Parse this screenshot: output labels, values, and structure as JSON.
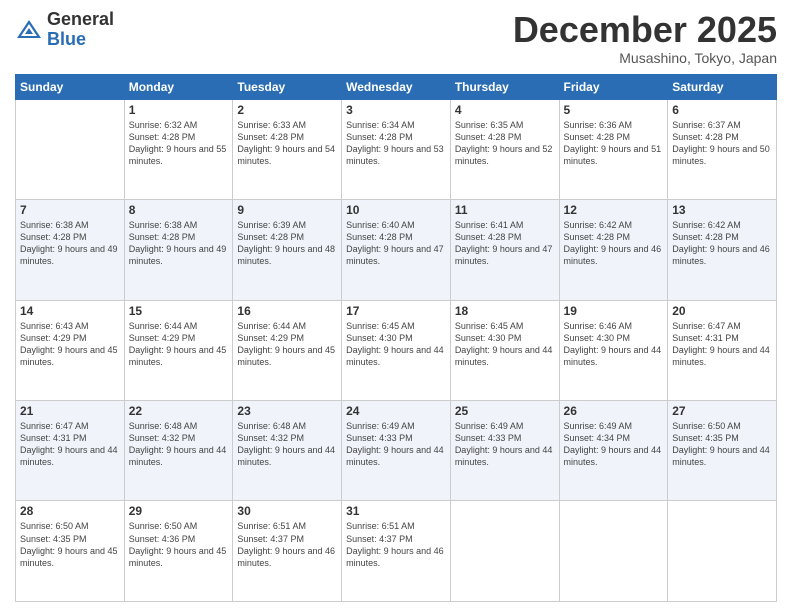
{
  "logo": {
    "general": "General",
    "blue": "Blue"
  },
  "header": {
    "month": "December 2025",
    "location": "Musashino, Tokyo, Japan"
  },
  "days": [
    "Sunday",
    "Monday",
    "Tuesday",
    "Wednesday",
    "Thursday",
    "Friday",
    "Saturday"
  ],
  "weeks": [
    [
      {
        "day": "",
        "sunrise": "",
        "sunset": "",
        "daylight": ""
      },
      {
        "day": "1",
        "sunrise": "Sunrise: 6:32 AM",
        "sunset": "Sunset: 4:28 PM",
        "daylight": "Daylight: 9 hours and 55 minutes."
      },
      {
        "day": "2",
        "sunrise": "Sunrise: 6:33 AM",
        "sunset": "Sunset: 4:28 PM",
        "daylight": "Daylight: 9 hours and 54 minutes."
      },
      {
        "day": "3",
        "sunrise": "Sunrise: 6:34 AM",
        "sunset": "Sunset: 4:28 PM",
        "daylight": "Daylight: 9 hours and 53 minutes."
      },
      {
        "day": "4",
        "sunrise": "Sunrise: 6:35 AM",
        "sunset": "Sunset: 4:28 PM",
        "daylight": "Daylight: 9 hours and 52 minutes."
      },
      {
        "day": "5",
        "sunrise": "Sunrise: 6:36 AM",
        "sunset": "Sunset: 4:28 PM",
        "daylight": "Daylight: 9 hours and 51 minutes."
      },
      {
        "day": "6",
        "sunrise": "Sunrise: 6:37 AM",
        "sunset": "Sunset: 4:28 PM",
        "daylight": "Daylight: 9 hours and 50 minutes."
      }
    ],
    [
      {
        "day": "7",
        "sunrise": "Sunrise: 6:38 AM",
        "sunset": "Sunset: 4:28 PM",
        "daylight": "Daylight: 9 hours and 49 minutes."
      },
      {
        "day": "8",
        "sunrise": "Sunrise: 6:38 AM",
        "sunset": "Sunset: 4:28 PM",
        "daylight": "Daylight: 9 hours and 49 minutes."
      },
      {
        "day": "9",
        "sunrise": "Sunrise: 6:39 AM",
        "sunset": "Sunset: 4:28 PM",
        "daylight": "Daylight: 9 hours and 48 minutes."
      },
      {
        "day": "10",
        "sunrise": "Sunrise: 6:40 AM",
        "sunset": "Sunset: 4:28 PM",
        "daylight": "Daylight: 9 hours and 47 minutes."
      },
      {
        "day": "11",
        "sunrise": "Sunrise: 6:41 AM",
        "sunset": "Sunset: 4:28 PM",
        "daylight": "Daylight: 9 hours and 47 minutes."
      },
      {
        "day": "12",
        "sunrise": "Sunrise: 6:42 AM",
        "sunset": "Sunset: 4:28 PM",
        "daylight": "Daylight: 9 hours and 46 minutes."
      },
      {
        "day": "13",
        "sunrise": "Sunrise: 6:42 AM",
        "sunset": "Sunset: 4:28 PM",
        "daylight": "Daylight: 9 hours and 46 minutes."
      }
    ],
    [
      {
        "day": "14",
        "sunrise": "Sunrise: 6:43 AM",
        "sunset": "Sunset: 4:29 PM",
        "daylight": "Daylight: 9 hours and 45 minutes."
      },
      {
        "day": "15",
        "sunrise": "Sunrise: 6:44 AM",
        "sunset": "Sunset: 4:29 PM",
        "daylight": "Daylight: 9 hours and 45 minutes."
      },
      {
        "day": "16",
        "sunrise": "Sunrise: 6:44 AM",
        "sunset": "Sunset: 4:29 PM",
        "daylight": "Daylight: 9 hours and 45 minutes."
      },
      {
        "day": "17",
        "sunrise": "Sunrise: 6:45 AM",
        "sunset": "Sunset: 4:30 PM",
        "daylight": "Daylight: 9 hours and 44 minutes."
      },
      {
        "day": "18",
        "sunrise": "Sunrise: 6:45 AM",
        "sunset": "Sunset: 4:30 PM",
        "daylight": "Daylight: 9 hours and 44 minutes."
      },
      {
        "day": "19",
        "sunrise": "Sunrise: 6:46 AM",
        "sunset": "Sunset: 4:30 PM",
        "daylight": "Daylight: 9 hours and 44 minutes."
      },
      {
        "day": "20",
        "sunrise": "Sunrise: 6:47 AM",
        "sunset": "Sunset: 4:31 PM",
        "daylight": "Daylight: 9 hours and 44 minutes."
      }
    ],
    [
      {
        "day": "21",
        "sunrise": "Sunrise: 6:47 AM",
        "sunset": "Sunset: 4:31 PM",
        "daylight": "Daylight: 9 hours and 44 minutes."
      },
      {
        "day": "22",
        "sunrise": "Sunrise: 6:48 AM",
        "sunset": "Sunset: 4:32 PM",
        "daylight": "Daylight: 9 hours and 44 minutes."
      },
      {
        "day": "23",
        "sunrise": "Sunrise: 6:48 AM",
        "sunset": "Sunset: 4:32 PM",
        "daylight": "Daylight: 9 hours and 44 minutes."
      },
      {
        "day": "24",
        "sunrise": "Sunrise: 6:49 AM",
        "sunset": "Sunset: 4:33 PM",
        "daylight": "Daylight: 9 hours and 44 minutes."
      },
      {
        "day": "25",
        "sunrise": "Sunrise: 6:49 AM",
        "sunset": "Sunset: 4:33 PM",
        "daylight": "Daylight: 9 hours and 44 minutes."
      },
      {
        "day": "26",
        "sunrise": "Sunrise: 6:49 AM",
        "sunset": "Sunset: 4:34 PM",
        "daylight": "Daylight: 9 hours and 44 minutes."
      },
      {
        "day": "27",
        "sunrise": "Sunrise: 6:50 AM",
        "sunset": "Sunset: 4:35 PM",
        "daylight": "Daylight: 9 hours and 44 minutes."
      }
    ],
    [
      {
        "day": "28",
        "sunrise": "Sunrise: 6:50 AM",
        "sunset": "Sunset: 4:35 PM",
        "daylight": "Daylight: 9 hours and 45 minutes."
      },
      {
        "day": "29",
        "sunrise": "Sunrise: 6:50 AM",
        "sunset": "Sunset: 4:36 PM",
        "daylight": "Daylight: 9 hours and 45 minutes."
      },
      {
        "day": "30",
        "sunrise": "Sunrise: 6:51 AM",
        "sunset": "Sunset: 4:37 PM",
        "daylight": "Daylight: 9 hours and 46 minutes."
      },
      {
        "day": "31",
        "sunrise": "Sunrise: 6:51 AM",
        "sunset": "Sunset: 4:37 PM",
        "daylight": "Daylight: 9 hours and 46 minutes."
      },
      {
        "day": "",
        "sunrise": "",
        "sunset": "",
        "daylight": ""
      },
      {
        "day": "",
        "sunrise": "",
        "sunset": "",
        "daylight": ""
      },
      {
        "day": "",
        "sunrise": "",
        "sunset": "",
        "daylight": ""
      }
    ]
  ]
}
